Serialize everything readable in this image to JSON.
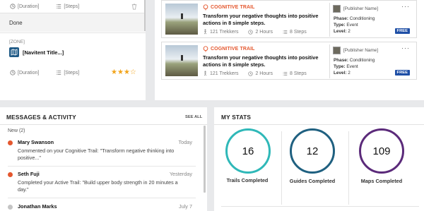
{
  "zone_panel": {
    "row1": {
      "duration": "[Duration]",
      "steps": "[Steps]"
    },
    "done_label": "Done",
    "zone_label": "[ZONE]",
    "navitent_title": "[Navitent Title...]",
    "row2": {
      "duration": "[Duration]",
      "steps": "[Steps]"
    },
    "stars": {
      "filled": 3,
      "total": 4
    }
  },
  "trail_cards": [
    {
      "type_label": "COGNITIVE TRAIL",
      "title": "Transform your negative thoughts into positive actions in 8 simple steps.",
      "trekkers": "121 Trekkers",
      "hours": "2 Hours",
      "steps": "8 Steps",
      "publisher": "[Publisher Name]",
      "phase_label": "Phase:",
      "phase": "Conditioning",
      "type_label2": "Type:",
      "type": "Event",
      "level_label": "Level:",
      "level": "2",
      "badge": "FREE",
      "menu": "···"
    },
    {
      "type_label": "COGNITIVE TRAIL",
      "title": "Transform your negative thoughts into positive actions in 8 simple steps.",
      "trekkers": "121 Trekkers",
      "hours": "2 Hours",
      "steps": "8 Steps",
      "publisher": "[Publisher Name]",
      "phase_label": "Phase:",
      "phase": "Conditioning",
      "type_label2": "Type:",
      "type": "Event",
      "level_label": "Level:",
      "level": "2",
      "badge": "FREE",
      "menu": "···"
    }
  ],
  "messages": {
    "title": "MESSAGES & ACTIVITY",
    "see_all": "SEE ALL",
    "new_label": "New (2)",
    "items": [
      {
        "name": "Mary Swanson",
        "date": "Today",
        "body": "Commented on your Cognitive Trail: \"Transform negative thinking into positive...\"",
        "dot_color": "#e4572e"
      },
      {
        "name": "Seth Fuji",
        "date": "Yesterday",
        "body": "Completed your Active Trail: \"Build upper body strength in 20 minutes a day.\"",
        "dot_color": "#e4572e"
      },
      {
        "name": "Jonathan Marks",
        "date": "July 7",
        "body": "",
        "dot_color": "#bbbbbb"
      }
    ]
  },
  "stats": {
    "title": "MY STATS",
    "items": [
      {
        "value": "16",
        "label": "Trails Completed",
        "color": "#2fb8b8"
      },
      {
        "value": "12",
        "label": "Guides Completed",
        "color": "#1f6080"
      },
      {
        "value": "109",
        "label": "Maps Completed",
        "color": "#5b2a7a"
      }
    ]
  }
}
